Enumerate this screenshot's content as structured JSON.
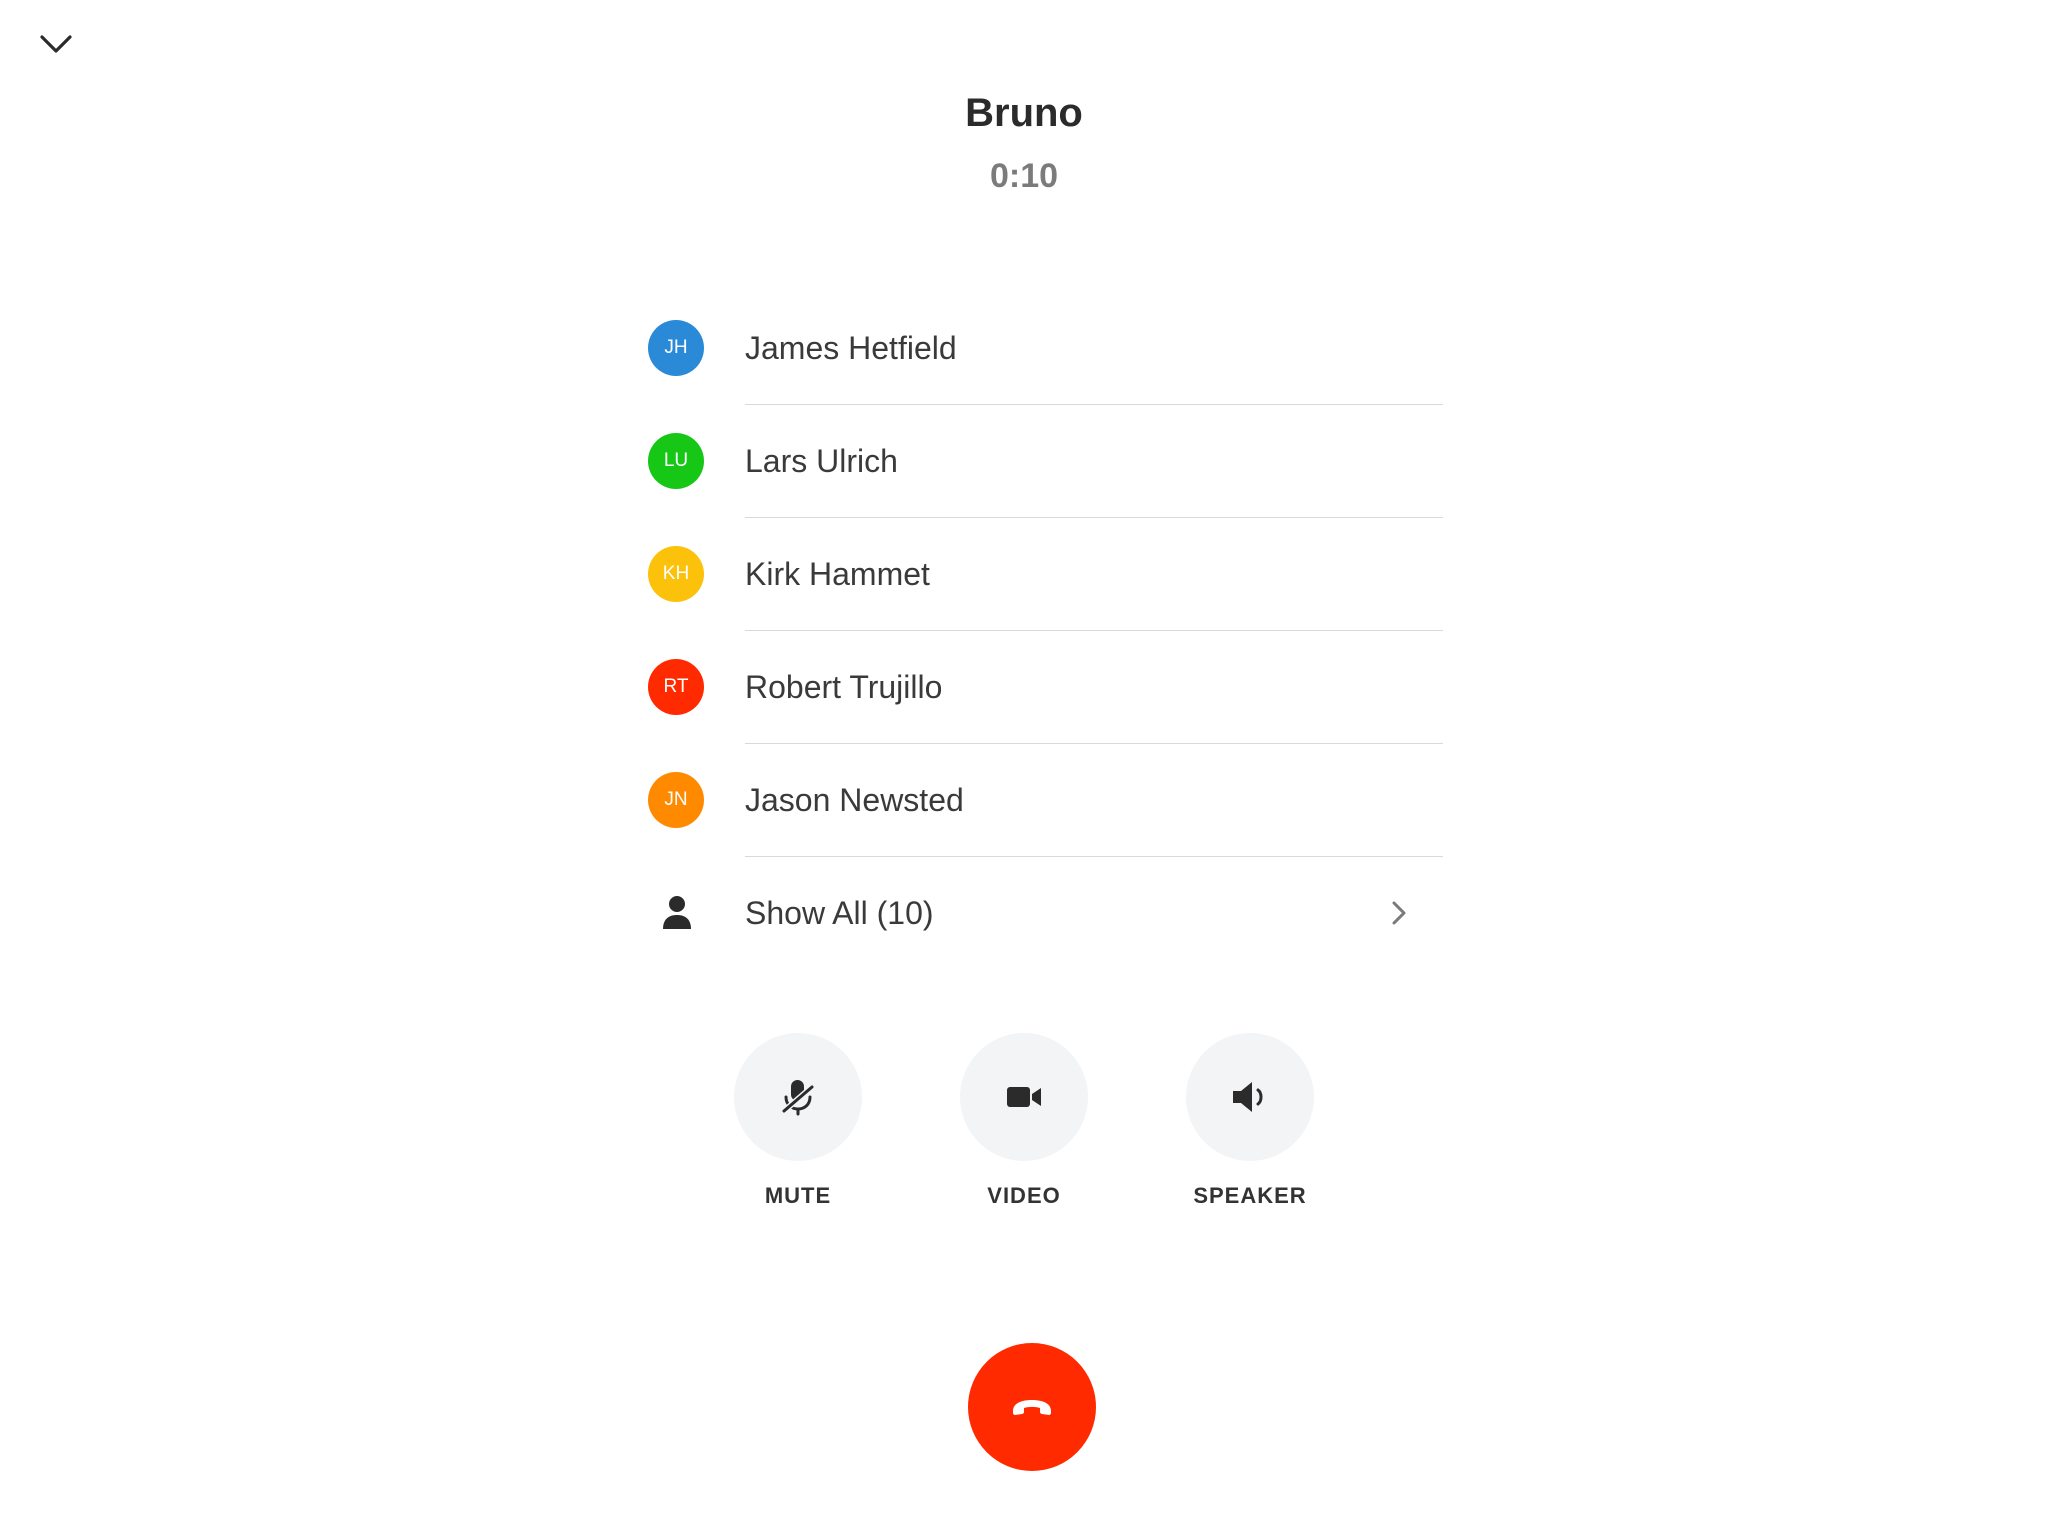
{
  "header": {
    "title": "Bruno",
    "timer": "0:10"
  },
  "participants": [
    {
      "initials": "JH",
      "name": "James Hetfield",
      "color": "#2a8ad8"
    },
    {
      "initials": "LU",
      "name": "Lars Ulrich",
      "color": "#16c716"
    },
    {
      "initials": "KH",
      "name": "Kirk Hammet",
      "color": "#fcc10a"
    },
    {
      "initials": "RT",
      "name": "Robert Trujillo",
      "color": "#ff2a00"
    },
    {
      "initials": "JN",
      "name": "Jason Newsted",
      "color": "#ff8a00"
    }
  ],
  "show_all": {
    "label": "Show All (10)",
    "icon": "person-icon"
  },
  "controls": {
    "mute_label": "MUTE",
    "video_label": "VIDEO",
    "speaker_label": "SPEAKER"
  },
  "colors": {
    "hangup": "#ff2a00",
    "control_bg": "#f3f4f6"
  }
}
